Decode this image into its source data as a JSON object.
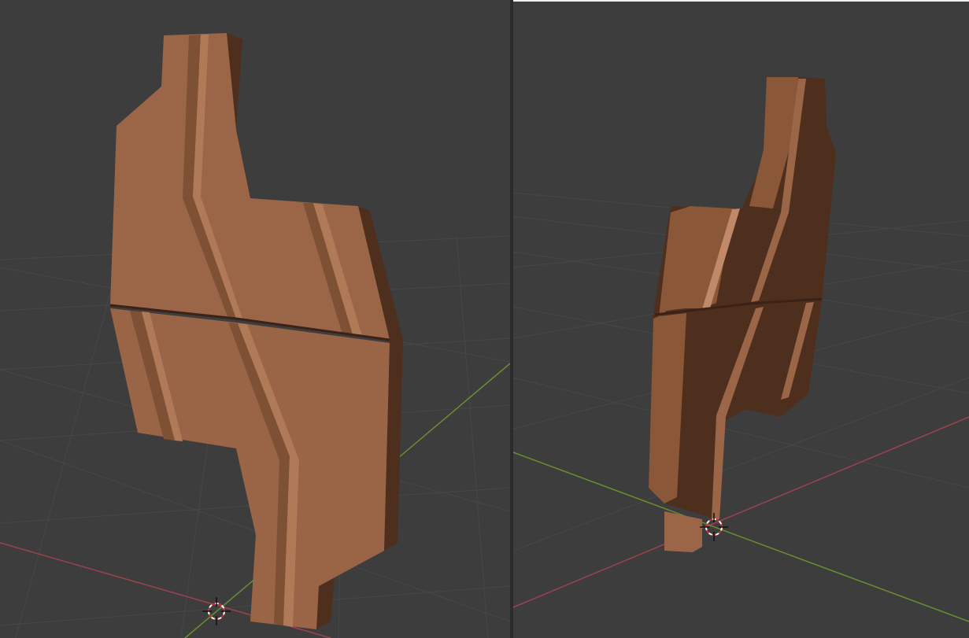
{
  "viewports": {
    "left": {
      "view": "viewport-left",
      "object": "3d-mesh-panel"
    },
    "right": {
      "view": "viewport-right",
      "object": "3d-mesh-panel"
    }
  },
  "colors": {
    "background": "#3d3d3d",
    "grid": "#4a4a4a",
    "x_axis": "#9a4250",
    "y_axis": "#6a8f2e",
    "mesh_light": "#9b6647",
    "mesh_mid": "#7f5134",
    "mesh_dark": "#4e2f1e"
  },
  "icons": {
    "cursor": "3d-cursor-icon"
  }
}
